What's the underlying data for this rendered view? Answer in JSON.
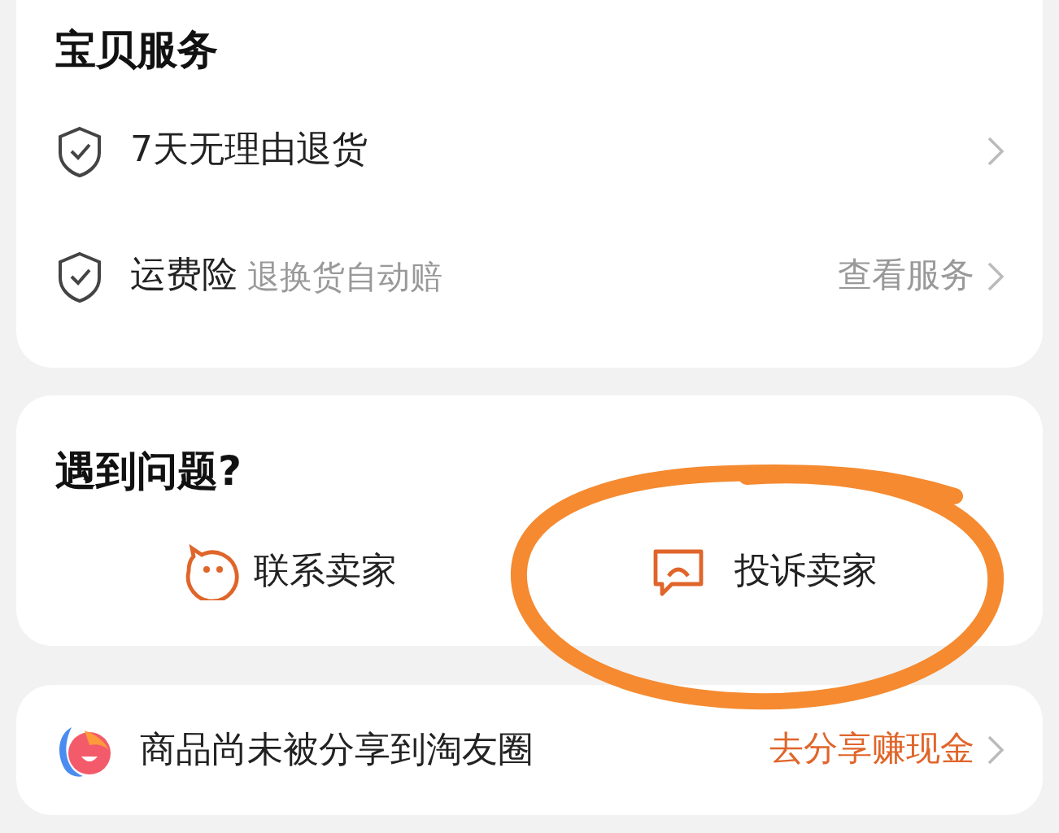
{
  "services": {
    "title": "宝贝服务",
    "rows": [
      {
        "label": "7天无理由退货",
        "note": null,
        "action": null
      },
      {
        "label": "运费险",
        "note": "退换货自动赔",
        "action": "查看服务"
      }
    ]
  },
  "problems": {
    "title": "遇到问题?",
    "actions": [
      {
        "kind": "contact",
        "label": "联系卖家",
        "circled": false
      },
      {
        "kind": "complain",
        "label": "投诉卖家",
        "circled": true
      }
    ]
  },
  "share": {
    "text": "商品尚未被分享到淘友圈",
    "action": "去分享赚现金"
  }
}
